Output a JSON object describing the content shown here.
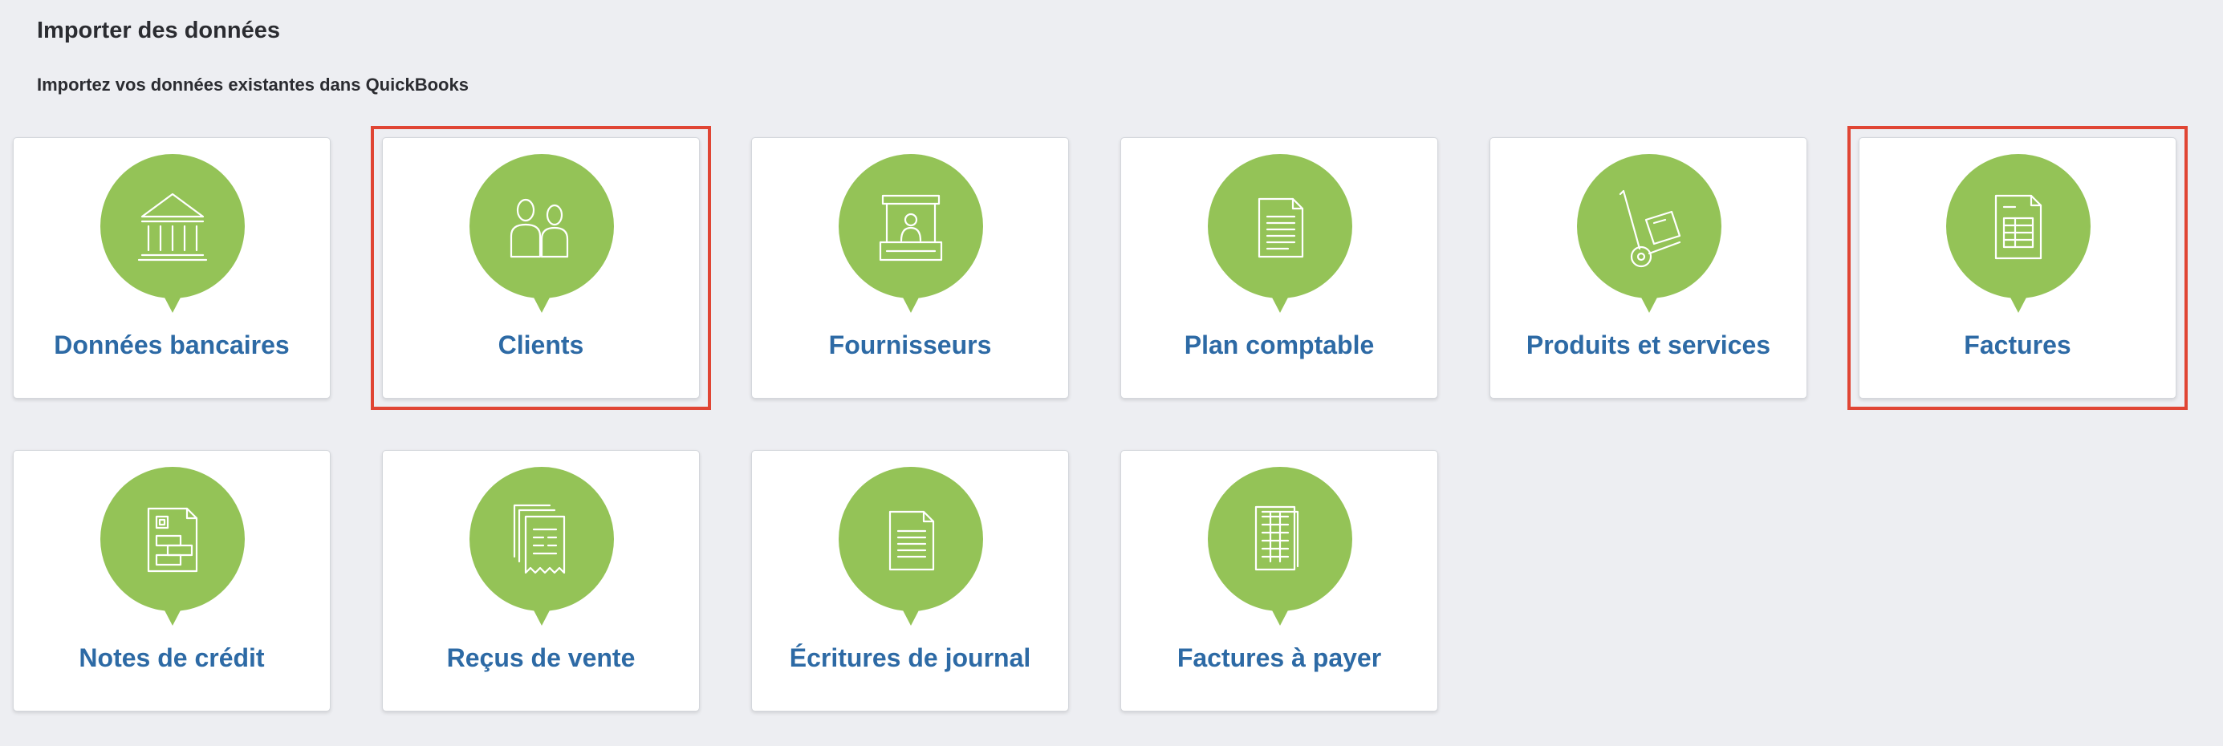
{
  "page": {
    "title": "Importer des données",
    "subtitle": "Importez vos données existantes dans QuickBooks"
  },
  "colors": {
    "background": "#edeef2",
    "bubble": "#94c357",
    "label": "#2d6aa5",
    "highlight": "#e04534"
  },
  "tiles": [
    {
      "label": "Données bancaires",
      "icon": "bank-icon",
      "highlighted": false
    },
    {
      "label": "Clients",
      "icon": "customers-icon",
      "highlighted": true
    },
    {
      "label": "Fournisseurs",
      "icon": "vendor-stand-icon",
      "highlighted": false
    },
    {
      "label": "Plan comptable",
      "icon": "document-icon",
      "highlighted": false
    },
    {
      "label": "Produits et services",
      "icon": "hand-truck-icon",
      "highlighted": false
    },
    {
      "label": "Factures",
      "icon": "invoice-icon",
      "highlighted": true
    },
    {
      "label": "Notes de crédit",
      "icon": "credit-note-icon",
      "highlighted": false
    },
    {
      "label": "Reçus de vente",
      "icon": "receipts-icon",
      "highlighted": false
    },
    {
      "label": "Écritures de journal",
      "icon": "journal-icon",
      "highlighted": false
    },
    {
      "label": "Factures à payer",
      "icon": "bills-icon",
      "highlighted": false
    }
  ]
}
